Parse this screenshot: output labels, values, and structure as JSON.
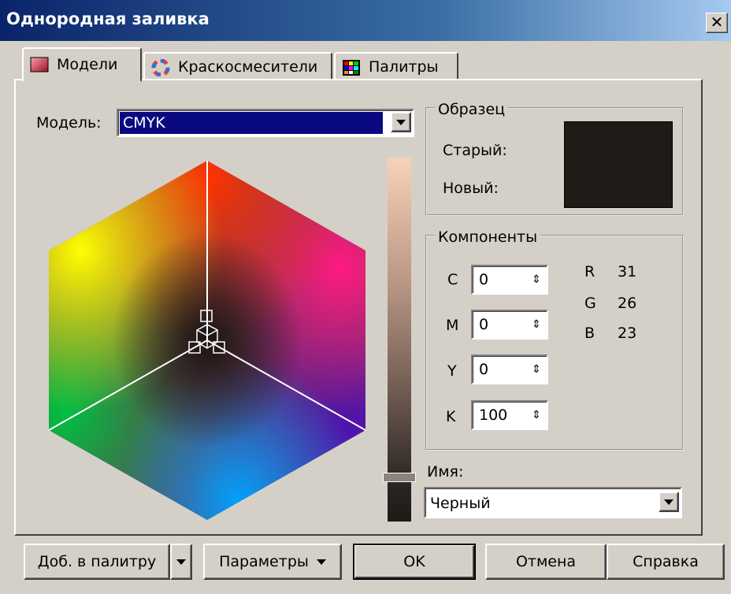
{
  "window": {
    "title": "Однородная заливка",
    "close_glyph": "✕"
  },
  "tabs": [
    {
      "label": "Модели",
      "icon": "color-square-icon"
    },
    {
      "label": "Краскосмесители",
      "icon": "color-wheel-icon"
    },
    {
      "label": "Палитры",
      "icon": "palette-grid-icon"
    }
  ],
  "model": {
    "label": "Модель:",
    "value": "CMYK"
  },
  "sample": {
    "title": "Образец",
    "old_label": "Старый:",
    "new_label": "Новый:",
    "old_color": "#211b17",
    "new_color": "#211b17"
  },
  "components": {
    "title": "Компоненты",
    "fields": [
      {
        "label": "C",
        "value": "0"
      },
      {
        "label": "M",
        "value": "0"
      },
      {
        "label": "Y",
        "value": "0"
      },
      {
        "label": "K",
        "value": "100"
      }
    ],
    "rgb": [
      {
        "label": "R",
        "value": "31"
      },
      {
        "label": "G",
        "value": "26"
      },
      {
        "label": "B",
        "value": "23"
      }
    ]
  },
  "name": {
    "label": "Имя:",
    "value": "Черный"
  },
  "buttons": {
    "add_to_palette": "Доб. в палитру",
    "parameters": "Параметры",
    "ok": "OK",
    "cancel": "Отмена",
    "help": "Справка"
  },
  "colors": {
    "title_bar": "#0a246a",
    "dialog_bg": "#d4d0c8",
    "selection": "#0a0a80"
  }
}
